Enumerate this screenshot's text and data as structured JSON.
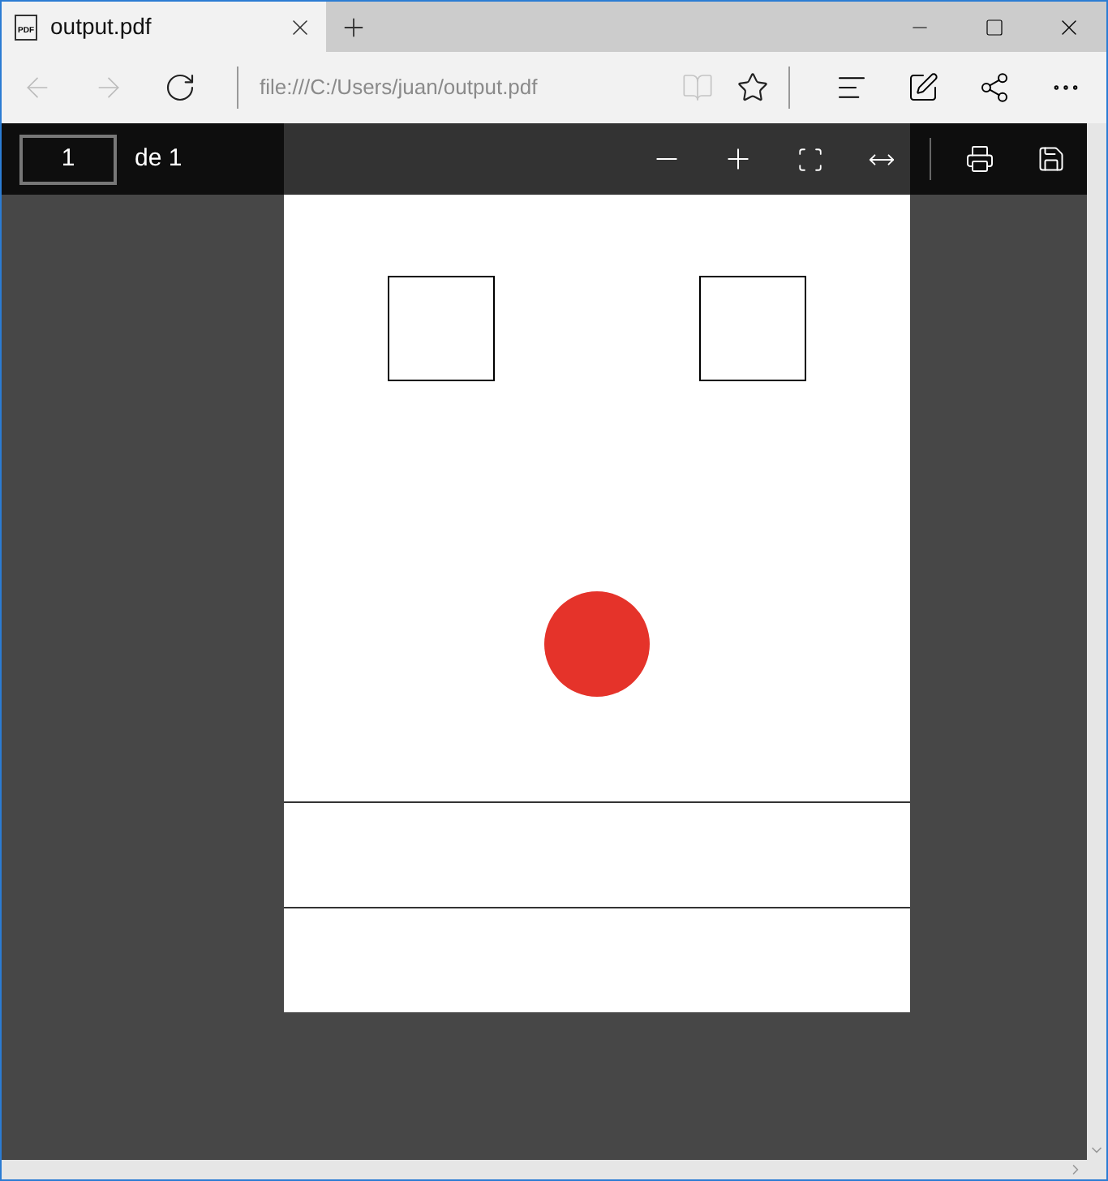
{
  "tab": {
    "title": "output.pdf",
    "icon_text": "PDF"
  },
  "address_bar": {
    "url": "file:///C:/Users/juan/output.pdf",
    "back_disabled": true,
    "forward_disabled": true
  },
  "pdf_toolbar": {
    "page_field": "1",
    "page_count": "de 1"
  }
}
